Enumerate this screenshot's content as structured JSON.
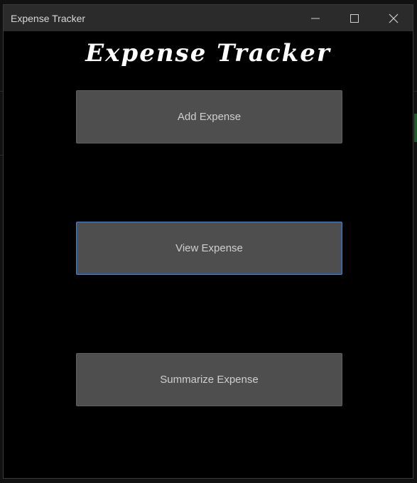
{
  "window": {
    "title": "Expense Tracker"
  },
  "header": {
    "heading": "Expense Tracker"
  },
  "actions": [
    {
      "label": "Add Expense",
      "focused": false
    },
    {
      "label": "View Expense",
      "focused": true
    },
    {
      "label": "Summarize Expense",
      "focused": false
    }
  ],
  "titlebar_controls": [
    "minimize-icon",
    "maximize-icon",
    "close-icon"
  ],
  "colors": {
    "window_bg": "#000000",
    "titlebar_bg": "#2b2b2b",
    "button_bg": "#4e4e4e",
    "focus_border": "#4a7cc4"
  }
}
